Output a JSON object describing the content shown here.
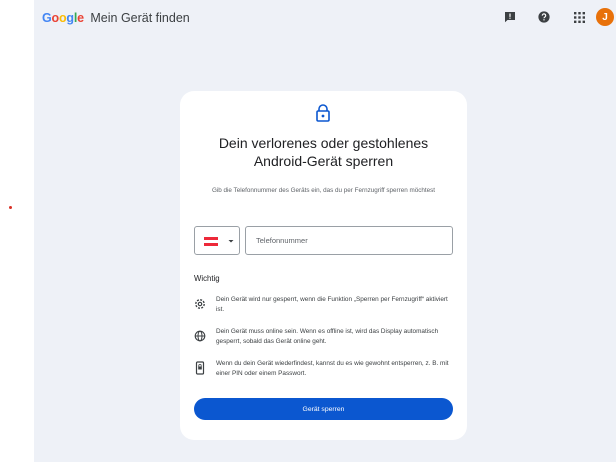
{
  "header": {
    "logo_letters": [
      "G",
      "o",
      "o",
      "g",
      "l",
      "e"
    ],
    "app_name": "Mein Gerät finden",
    "icons": [
      "feedback-icon",
      "help-icon",
      "apps-grid-icon"
    ],
    "avatar_initial": "J"
  },
  "card": {
    "title_line1": "Dein verlorenes oder gestohlenes",
    "title_line2": "Android-Gerät sperren",
    "subtitle": "Gib die Telefonnummer des Geräts ein, das du per Fernzugriff sperren möchtest",
    "phone_placeholder": "Telefonnummer",
    "important_heading": "Wichtig",
    "items": [
      {
        "icon": "settings-icon",
        "text": "Dein Gerät wird nur gesperrt, wenn die Funktion „Sperren per Fernzugriff“ aktiviert ist."
      },
      {
        "icon": "globe-icon",
        "text": "Dein Gerät muss online sein. Wenn es offline ist, wird das Display automatisch gesperrt, sobald das Gerät online geht."
      },
      {
        "icon": "phone-lock-icon",
        "text": "Wenn du dein Gerät wiederfindest, kannst du es wie gewohnt entsperren, z. B. mit einer PIN oder einem Passwort."
      }
    ],
    "button_label": "Gerät sperren"
  },
  "colors": {
    "background": "#eef1f7",
    "primary_button": "#0b57d0",
    "avatar": "#e8710a",
    "flag_red": "#ed2939",
    "flag_white": "#ffffff"
  }
}
